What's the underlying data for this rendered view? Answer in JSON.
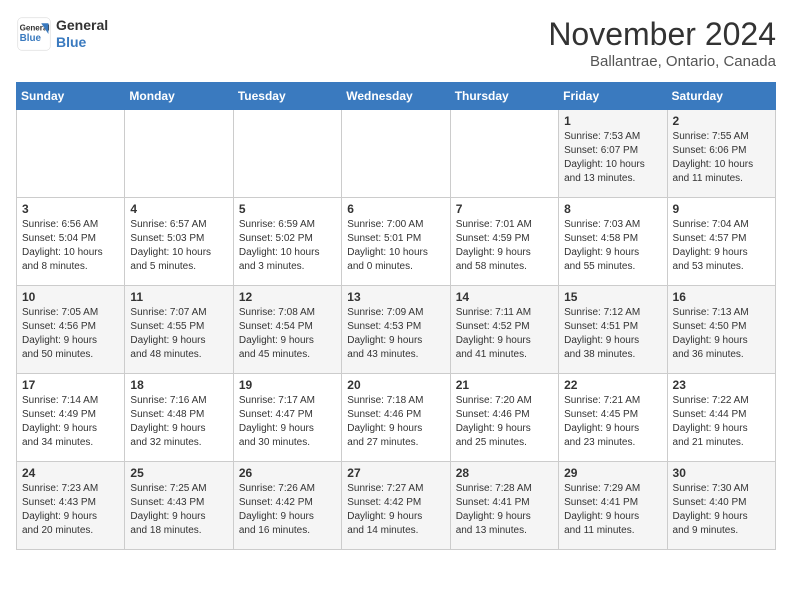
{
  "header": {
    "logo_line1": "General",
    "logo_line2": "Blue",
    "month": "November 2024",
    "location": "Ballantrae, Ontario, Canada"
  },
  "weekdays": [
    "Sunday",
    "Monday",
    "Tuesday",
    "Wednesday",
    "Thursday",
    "Friday",
    "Saturday"
  ],
  "weeks": [
    [
      {
        "day": "",
        "info": ""
      },
      {
        "day": "",
        "info": ""
      },
      {
        "day": "",
        "info": ""
      },
      {
        "day": "",
        "info": ""
      },
      {
        "day": "",
        "info": ""
      },
      {
        "day": "1",
        "info": "Sunrise: 7:53 AM\nSunset: 6:07 PM\nDaylight: 10 hours\nand 13 minutes."
      },
      {
        "day": "2",
        "info": "Sunrise: 7:55 AM\nSunset: 6:06 PM\nDaylight: 10 hours\nand 11 minutes."
      }
    ],
    [
      {
        "day": "3",
        "info": "Sunrise: 6:56 AM\nSunset: 5:04 PM\nDaylight: 10 hours\nand 8 minutes."
      },
      {
        "day": "4",
        "info": "Sunrise: 6:57 AM\nSunset: 5:03 PM\nDaylight: 10 hours\nand 5 minutes."
      },
      {
        "day": "5",
        "info": "Sunrise: 6:59 AM\nSunset: 5:02 PM\nDaylight: 10 hours\nand 3 minutes."
      },
      {
        "day": "6",
        "info": "Sunrise: 7:00 AM\nSunset: 5:01 PM\nDaylight: 10 hours\nand 0 minutes."
      },
      {
        "day": "7",
        "info": "Sunrise: 7:01 AM\nSunset: 4:59 PM\nDaylight: 9 hours\nand 58 minutes."
      },
      {
        "day": "8",
        "info": "Sunrise: 7:03 AM\nSunset: 4:58 PM\nDaylight: 9 hours\nand 55 minutes."
      },
      {
        "day": "9",
        "info": "Sunrise: 7:04 AM\nSunset: 4:57 PM\nDaylight: 9 hours\nand 53 minutes."
      }
    ],
    [
      {
        "day": "10",
        "info": "Sunrise: 7:05 AM\nSunset: 4:56 PM\nDaylight: 9 hours\nand 50 minutes."
      },
      {
        "day": "11",
        "info": "Sunrise: 7:07 AM\nSunset: 4:55 PM\nDaylight: 9 hours\nand 48 minutes."
      },
      {
        "day": "12",
        "info": "Sunrise: 7:08 AM\nSunset: 4:54 PM\nDaylight: 9 hours\nand 45 minutes."
      },
      {
        "day": "13",
        "info": "Sunrise: 7:09 AM\nSunset: 4:53 PM\nDaylight: 9 hours\nand 43 minutes."
      },
      {
        "day": "14",
        "info": "Sunrise: 7:11 AM\nSunset: 4:52 PM\nDaylight: 9 hours\nand 41 minutes."
      },
      {
        "day": "15",
        "info": "Sunrise: 7:12 AM\nSunset: 4:51 PM\nDaylight: 9 hours\nand 38 minutes."
      },
      {
        "day": "16",
        "info": "Sunrise: 7:13 AM\nSunset: 4:50 PM\nDaylight: 9 hours\nand 36 minutes."
      }
    ],
    [
      {
        "day": "17",
        "info": "Sunrise: 7:14 AM\nSunset: 4:49 PM\nDaylight: 9 hours\nand 34 minutes."
      },
      {
        "day": "18",
        "info": "Sunrise: 7:16 AM\nSunset: 4:48 PM\nDaylight: 9 hours\nand 32 minutes."
      },
      {
        "day": "19",
        "info": "Sunrise: 7:17 AM\nSunset: 4:47 PM\nDaylight: 9 hours\nand 30 minutes."
      },
      {
        "day": "20",
        "info": "Sunrise: 7:18 AM\nSunset: 4:46 PM\nDaylight: 9 hours\nand 27 minutes."
      },
      {
        "day": "21",
        "info": "Sunrise: 7:20 AM\nSunset: 4:46 PM\nDaylight: 9 hours\nand 25 minutes."
      },
      {
        "day": "22",
        "info": "Sunrise: 7:21 AM\nSunset: 4:45 PM\nDaylight: 9 hours\nand 23 minutes."
      },
      {
        "day": "23",
        "info": "Sunrise: 7:22 AM\nSunset: 4:44 PM\nDaylight: 9 hours\nand 21 minutes."
      }
    ],
    [
      {
        "day": "24",
        "info": "Sunrise: 7:23 AM\nSunset: 4:43 PM\nDaylight: 9 hours\nand 20 minutes."
      },
      {
        "day": "25",
        "info": "Sunrise: 7:25 AM\nSunset: 4:43 PM\nDaylight: 9 hours\nand 18 minutes."
      },
      {
        "day": "26",
        "info": "Sunrise: 7:26 AM\nSunset: 4:42 PM\nDaylight: 9 hours\nand 16 minutes."
      },
      {
        "day": "27",
        "info": "Sunrise: 7:27 AM\nSunset: 4:42 PM\nDaylight: 9 hours\nand 14 minutes."
      },
      {
        "day": "28",
        "info": "Sunrise: 7:28 AM\nSunset: 4:41 PM\nDaylight: 9 hours\nand 13 minutes."
      },
      {
        "day": "29",
        "info": "Sunrise: 7:29 AM\nSunset: 4:41 PM\nDaylight: 9 hours\nand 11 minutes."
      },
      {
        "day": "30",
        "info": "Sunrise: 7:30 AM\nSunset: 4:40 PM\nDaylight: 9 hours\nand 9 minutes."
      }
    ]
  ]
}
